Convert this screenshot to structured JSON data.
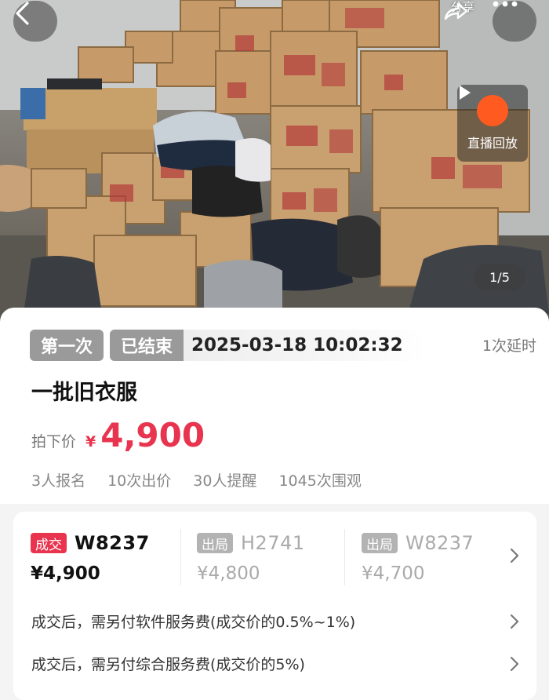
{
  "hero": {
    "share_label": "分享",
    "replay_label": "直播回放",
    "pager": "1/5"
  },
  "auction": {
    "round_tag": "第一次",
    "status_tag": "已结束",
    "end_time": "2025-03-18 10:02:32",
    "delay_text": "1次延时",
    "title": "一批旧衣服",
    "final_price_label": "拍下价",
    "currency": "¥",
    "final_price": "4,900",
    "stats": [
      "3人报名",
      "10次出价",
      "30人提醒",
      "1045次围观"
    ]
  },
  "bids": [
    {
      "badge": "成交",
      "code": "W8237",
      "price": "¥4,900",
      "status": "deal"
    },
    {
      "badge": "出局",
      "code": "H2741",
      "price": "¥4,800",
      "status": "out"
    },
    {
      "badge": "出局",
      "code": "W8237",
      "price": "¥4,700",
      "status": "out"
    }
  ],
  "fees": [
    "成交后，需另付软件服务费(成交价的0.5%~1%)",
    "成交后，需另付综合服务费(成交价的5%)"
  ],
  "colors": {
    "accent": "#e8344e",
    "replay": "#ff5a1f"
  }
}
